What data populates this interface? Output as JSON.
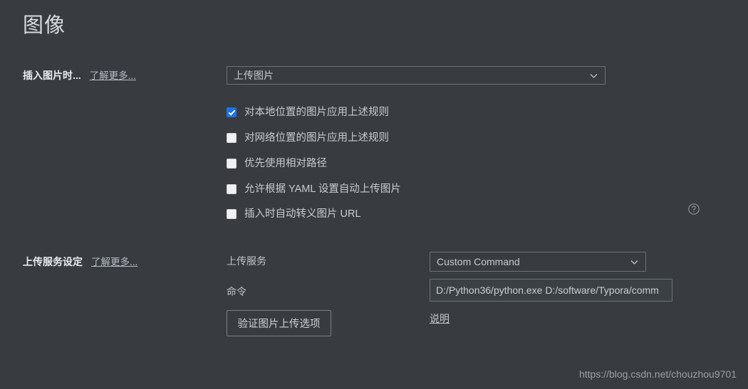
{
  "page": {
    "title": "图像",
    "watermark": "https://blog.csdn.net/chouzhou9701",
    "background_color": "#383c40",
    "accent_color": "#1a73e8"
  },
  "insert_section": {
    "label": "插入图片时...",
    "learn_more": "了解更多...",
    "action_select": {
      "value": "上传图片",
      "icon": "chevron-down-icon"
    },
    "checkboxes": [
      {
        "label": "对本地位置的图片应用上述规则",
        "checked": true
      },
      {
        "label": "对网络位置的图片应用上述规则",
        "checked": false
      },
      {
        "label": "优先使用相对路径",
        "checked": false
      },
      {
        "label": "允许根据 YAML 设置自动上传图片",
        "checked": false
      },
      {
        "label": "插入时自动转义图片 URL",
        "checked": false
      }
    ],
    "help_icon": "help-circle-icon"
  },
  "upload_section": {
    "label": "上传服务设定",
    "learn_more": "了解更多...",
    "service_label": "上传服务",
    "service_select": {
      "value": "Custom Command",
      "icon": "chevron-down-icon"
    },
    "command_label": "命令",
    "command_input": {
      "value": "D:/Python36/python.exe D:/software/Typora/comm",
      "placeholder": ""
    },
    "description_link": "说明",
    "verify_button": "验证图片上传选项"
  }
}
